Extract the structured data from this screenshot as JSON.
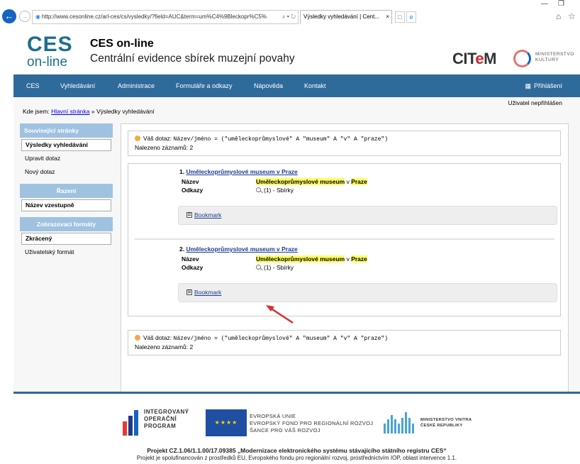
{
  "browser": {
    "url": "http://www.cesonline.cz/arl-ces/cs/vysledky/?field=AUC&term=um%C4%9Bleckopr%C5%",
    "tab_title": "Výsledky vyhledávání | Cent...",
    "url_controls": "⌕ ▾ ↻"
  },
  "header": {
    "logo_line1": "CES",
    "logo_line2": "on-line",
    "title": "CES on-line",
    "subtitle": "Centrální evidence sbírek muzejní povahy",
    "citem_pre": "CIT",
    "citem_e": "e",
    "citem_post": "M",
    "ministry_line1": "MINISTERSTVO",
    "ministry_line2": "KULTURY"
  },
  "nav": {
    "items": [
      "CES",
      "Vyhledávání",
      "Administrace",
      "Formuláře a odkazy",
      "Nápověda",
      "Kontakt"
    ],
    "login": "Přihlášení"
  },
  "breadcrumb": {
    "prefix": "Kde jsem:",
    "home": "Hlavní stránka",
    "separator": "»",
    "current": "Výsledky vyhledávání"
  },
  "user_status": "Uživatel nepřihlášen",
  "sidebar": {
    "related": {
      "title": "Související stránky",
      "items": [
        "Výsledky vyhledávání",
        "Upravit dotaz",
        "Nový dotaz"
      ]
    },
    "sorting": {
      "title": "Řazení",
      "items": [
        "Název vzestupně"
      ]
    },
    "formats": {
      "title": "Zobrazovací formáty",
      "items": [
        "Zkrácený",
        "Uživatelský formát"
      ]
    }
  },
  "query": {
    "label": "Váš dotaz:",
    "expression": "Název/jméno = (\"uměleckoprůmyslové\" A \"museum\" A \"v\" A \"praze\")",
    "found_label": "Nalezeno záznamů:",
    "found_count": "2"
  },
  "results": [
    {
      "number": "1.",
      "title": "Uměleckoprůmyslové museum v Praze",
      "name_label": "Název",
      "name_hl1": "Uměleckoprůmyslové museum",
      "name_mid": "v",
      "name_hl2": "Praze",
      "refs_label": "Odkazy",
      "refs_value": "(1) - Sbírky",
      "bookmark": "Bookmark"
    },
    {
      "number": "2.",
      "title": "Uměleckoprůmyslové museum v Praze",
      "name_label": "Název",
      "name_hl1": "Uměleckoprůmyslové museum",
      "name_mid": "v",
      "name_hl2": "Praze",
      "refs_label": "Odkazy",
      "refs_value": "(1) - Sbírky",
      "bookmark": "Bookmark"
    }
  ],
  "footer": {
    "iop_lines": [
      "INTEGROVANÝ",
      "OPERAČNÍ",
      "PROGRAM"
    ],
    "eu_lines": [
      "EVROPSKÁ UNIE",
      "EVROPSKÝ FOND PRO REGIONÁLNÍ ROZVOJ",
      "ŠANCE PRO VÁŠ ROZVOJ"
    ],
    "mv_lines": [
      "MINISTERSTVO VNITRA",
      "ČESKÉ REPUBLIKY"
    ],
    "project_title": "Projekt CZ.1.06/1.1.00/17.09385 „Modernizace elektronického systému stávajícího státního registru CES“",
    "project_note": "Projekt je spolufinancován z prostředků EU, Evropského fondu pro regionální rozvoj, prostřednictvím IOP, oblast intervence 1.1."
  }
}
